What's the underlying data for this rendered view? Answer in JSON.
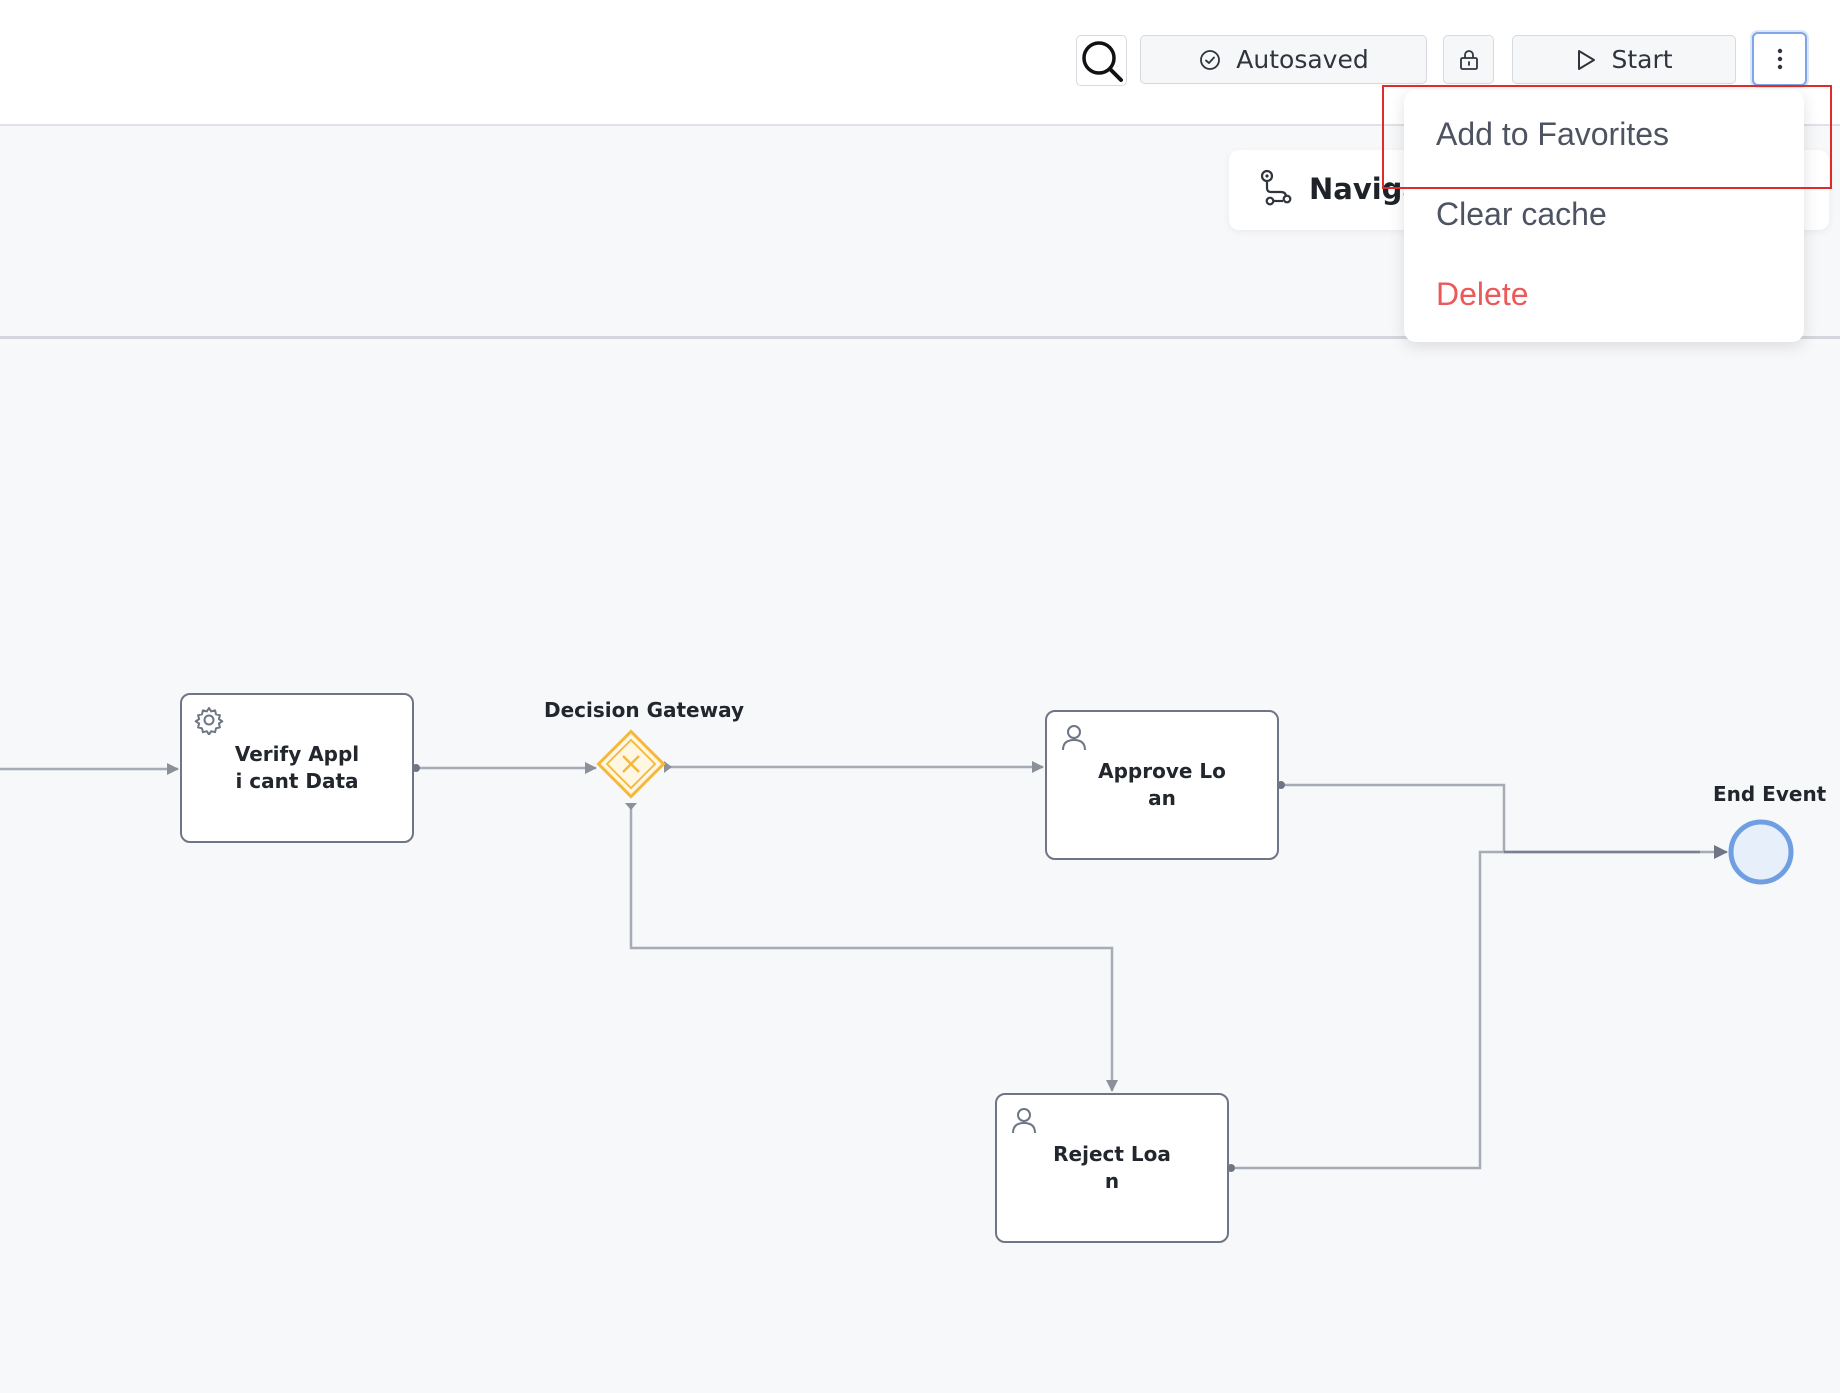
{
  "toolbar": {
    "search_icon": "search-icon",
    "autosaved_label": "Autosaved",
    "autosaved_icon": "check-circle-icon",
    "lock_icon": "lock-icon",
    "start_label": "Start",
    "start_icon": "play-icon",
    "more_icon": "more-vertical-icon"
  },
  "navigate_panel": {
    "label": "Naviga",
    "icon": "route-icon"
  },
  "menu": {
    "items": [
      {
        "label": "Add to Favorites"
      },
      {
        "label": "Clear cache"
      },
      {
        "label": "Delete",
        "color": "#ea5a5a"
      }
    ]
  },
  "diagram": {
    "tasks": [
      {
        "label": "Verify Appli cant Data",
        "icon": "gear-icon"
      },
      {
        "label": "Approve Lo an",
        "icon": "user-icon"
      },
      {
        "label": "Reject Loa n",
        "icon": "user-icon"
      }
    ],
    "gateway": {
      "label": "Decision Gateway",
      "icon": "exclusive-gateway-icon",
      "color": "#f5b83d"
    },
    "end_event": {
      "label": "End Event",
      "color": "#6f9ee3"
    }
  },
  "colors": {
    "highlight": "#e02b2b",
    "focus_ring": "#7fa6e6",
    "connector": "#a6abb4"
  }
}
